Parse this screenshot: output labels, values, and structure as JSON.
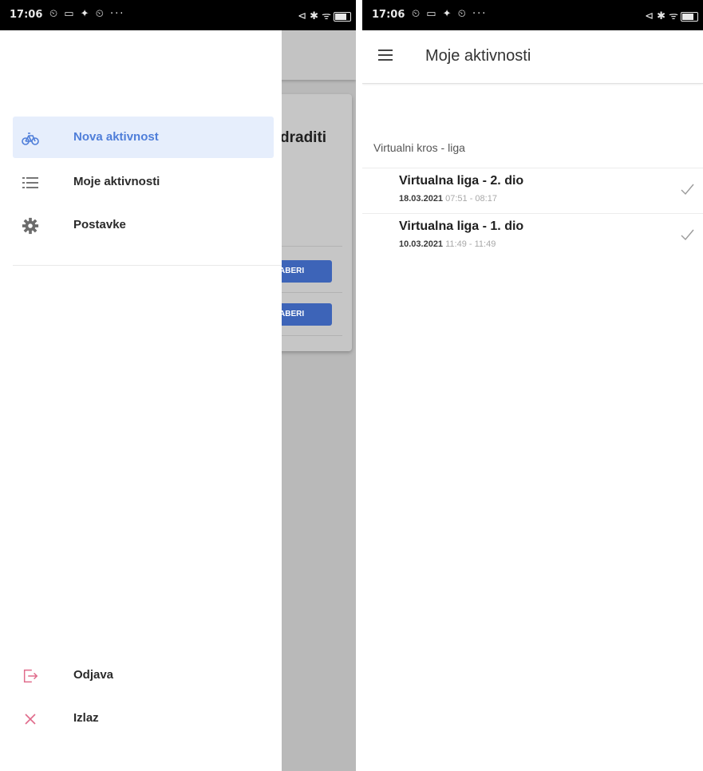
{
  "left_screen": {
    "status_bar": {
      "time": "17:06",
      "left_icons": "⏲ ▭ ✦ ⏲ ···",
      "right_icons": "⊲ ✱ ᯤ"
    },
    "background_app": {
      "card_title": "draditi",
      "button_labels": [
        "ABERI",
        "ABERI"
      ]
    },
    "drawer": {
      "items": [
        {
          "label": "Nova aktivnost",
          "icon": "bicycle-icon",
          "active": true
        },
        {
          "label": "Moje aktivnosti",
          "icon": "list-icon",
          "active": false
        },
        {
          "label": "Postavke",
          "icon": "gear-icon",
          "active": false
        }
      ],
      "bottom_items": [
        {
          "label": "Odjava",
          "icon": "logout-icon"
        },
        {
          "label": "Izlaz",
          "icon": "close-icon"
        }
      ]
    }
  },
  "right_screen": {
    "status_bar": {
      "time": "17:06",
      "left_icons": "⏲ ▭ ✦ ⏲ ···",
      "right_icons": "⊲ ✱ ᯤ"
    },
    "app_bar": {
      "title": "Moje aktivnosti",
      "menu_icon": "menu-icon"
    },
    "section": {
      "title": "Virtualni kros - liga",
      "items": [
        {
          "name": "Virtualna liga - 2. dio",
          "date": "18.03.2021",
          "time": "07:51 - 08:17",
          "status_icon": "check-icon"
        },
        {
          "name": "Virtualna liga - 1. dio",
          "date": "10.03.2021",
          "time": "11:49 - 11:49",
          "status_icon": "check-icon"
        }
      ]
    }
  },
  "colors": {
    "accent": "#4f7ed9",
    "active_bg": "#e6eefc",
    "logout_icon": "#e06b8b",
    "close_icon": "#e06b8b",
    "bg_button": "#3d64b8"
  }
}
